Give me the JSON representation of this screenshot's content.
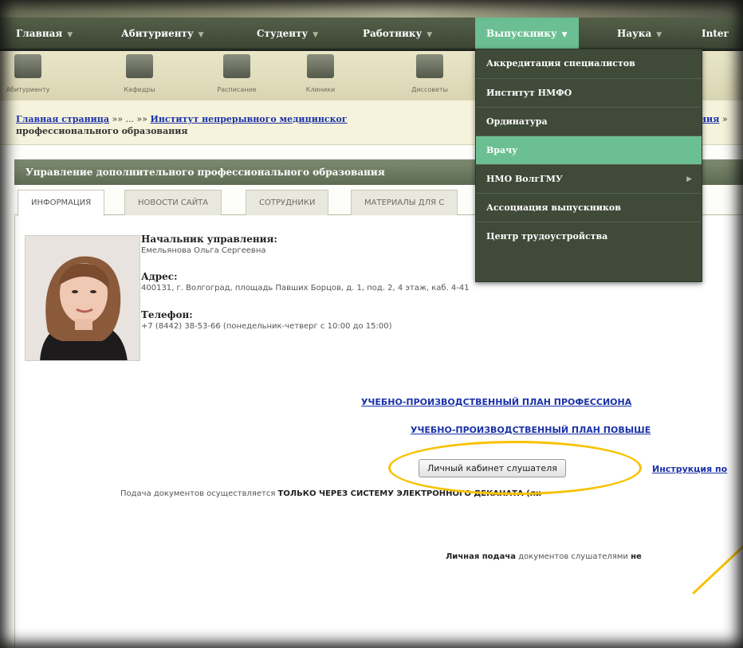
{
  "nav": {
    "items": [
      {
        "label": "Главная"
      },
      {
        "label": "Абитуриенту"
      },
      {
        "label": "Студенту"
      },
      {
        "label": "Работнику"
      },
      {
        "label": "Выпускнику"
      },
      {
        "label": "Наука"
      },
      {
        "label": "Inter"
      }
    ],
    "active_index": 4
  },
  "icons": [
    {
      "label": "Абитуриенту",
      "icon": "applicant-icon"
    },
    {
      "label": "Кафедры",
      "icon": "departments-icon"
    },
    {
      "label": "Расписание",
      "icon": "calendar-icon"
    },
    {
      "label": "Клиники",
      "icon": "clinics-icon"
    },
    {
      "label": "Диссоветы",
      "icon": "graduation-cap-icon"
    }
  ],
  "breadcrumb": {
    "home": "Главная страница",
    "sep1": " »» ... »» ",
    "institute": "Институт непрерывного медицинског",
    "tail_link": "ния",
    "tail_sep": " »",
    "line2": "профессионального образования"
  },
  "section": {
    "title": "Управление дополнительного профессионального образования"
  },
  "tabs": [
    {
      "label": "ИНФОРМАЦИЯ"
    },
    {
      "label": "НОВОСТИ САЙТА"
    },
    {
      "label": "СОТРУДНИКИ"
    },
    {
      "label": "МАТЕРИАЛЫ ДЛЯ С"
    }
  ],
  "head_of_dept": {
    "label": "Начальник управления:",
    "name": "Емельянова Ольга Сергеевна",
    "address_label": "Адрес:",
    "address": "400131, г. Волгоград, площадь Павших Борцов, д. 1, под. 2, 4 этаж, каб. 4-41",
    "phone_label": "Телефон:",
    "phone": "+7 (8442) 38-53-66 (понедельник-четверг с 10:00 до 15:00)"
  },
  "links": {
    "plan1": "УЧЕБНО-ПРОИЗВОДСТВЕННЫЙ ПЛАН ПРОФЕССИОНА",
    "plan2": "УЧЕБНО-ПРОИЗВОДСТВЕННЫЙ ПЛАН ПОВЫШЕ"
  },
  "notice": {
    "prefix": "Подача документов осуществляется ",
    "bold": "ТОЛЬКО ЧЕРЕЗ СИСТЕМУ ЭЛЕКТРОННОГО ДЕКАНАТА (ли",
    "personal_bold": "Личная подача",
    "personal_rest": " документов слушателями ",
    "personal_end": "не"
  },
  "buttons": {
    "cabinet": "Личный кабинет слушателя",
    "instruction": "Инструкция по"
  },
  "dropdown": {
    "items": [
      {
        "label": "Аккредитация специалистов"
      },
      {
        "label": "Институт НМФО"
      },
      {
        "label": "Ординатура"
      },
      {
        "label": "Врачу"
      },
      {
        "label": "НМО ВолгГМУ",
        "submenu": true
      },
      {
        "label": "Ассоциация выпускников"
      },
      {
        "label": "Центр трудоустройства"
      }
    ],
    "active_index": 3
  },
  "colors": {
    "nav_bg": "#3c4634",
    "active_green": "#6bbf93",
    "link_blue": "#1a32a8",
    "highlight_yellow": "#f7c200"
  }
}
